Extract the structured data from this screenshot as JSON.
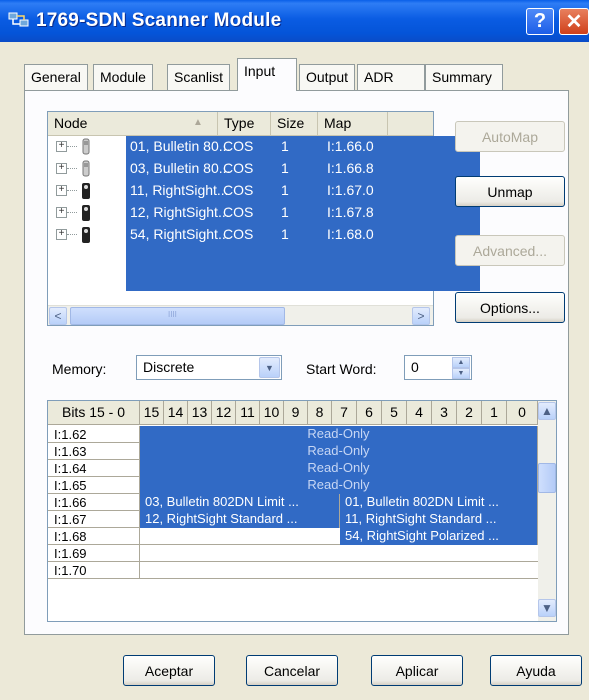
{
  "window": {
    "title": "1769-SDN Scanner Module",
    "help_label": "?",
    "close_label": "✕"
  },
  "tabs": [
    {
      "label": "General"
    },
    {
      "label": "Module"
    },
    {
      "label": "Scanlist"
    },
    {
      "label": "Input"
    },
    {
      "label": "Output"
    },
    {
      "label": "ADR"
    },
    {
      "label": "Summary"
    }
  ],
  "node_list": {
    "columns": [
      "Node",
      "Type",
      "Size",
      "Map"
    ],
    "rows": [
      {
        "node": "01, Bulletin 80...",
        "type": "COS",
        "size": "1",
        "map": "I:1.66.0",
        "icon": "limit-switch-icon"
      },
      {
        "node": "03, Bulletin 80...",
        "type": "COS",
        "size": "1",
        "map": "I:1.66.8",
        "icon": "limit-switch-icon"
      },
      {
        "node": "11, RightSight...",
        "type": "COS",
        "size": "1",
        "map": "I:1.67.0",
        "icon": "photoelectric-sensor-icon"
      },
      {
        "node": "12, RightSight...",
        "type": "COS",
        "size": "1",
        "map": "I:1.67.8",
        "icon": "photoelectric-sensor-icon"
      },
      {
        "node": "54, RightSight...",
        "type": "COS",
        "size": "1",
        "map": "I:1.68.0",
        "icon": "photoelectric-sensor-icon"
      }
    ],
    "scroll_left": "<",
    "scroll_right": ">",
    "thumb_grip": "IIII"
  },
  "buttons": {
    "automap": "AutoMap",
    "unmap": "Unmap",
    "advanced": "Advanced...",
    "options": "Options..."
  },
  "memory": {
    "label": "Memory:",
    "value": "Discrete",
    "start_word_label": "Start Word:",
    "start_word_value": "0"
  },
  "bit_grid": {
    "header_label": "Bits 15 - 0",
    "bits": [
      "15",
      "14",
      "13",
      "12",
      "11",
      "10",
      "9",
      "8",
      "7",
      "6",
      "5",
      "4",
      "3",
      "2",
      "1",
      "0"
    ],
    "rows": [
      {
        "label": "I:1.62",
        "full": "Read-Only"
      },
      {
        "label": "I:1.63",
        "full": "Read-Only"
      },
      {
        "label": "I:1.64",
        "full": "Read-Only"
      },
      {
        "label": "I:1.65",
        "full": "Read-Only"
      },
      {
        "label": "I:1.66",
        "high": "03, Bulletin 802DN Limit ...",
        "low": "01, Bulletin 802DN Limit ..."
      },
      {
        "label": "I:1.67",
        "high": "12, RightSight Standard ...",
        "low": "11, RightSight Standard ..."
      },
      {
        "label": "I:1.68",
        "high": "",
        "low": "54, RightSight Polarized ..."
      },
      {
        "label": "I:1.69"
      },
      {
        "label": "I:1.70"
      }
    ]
  },
  "footer": {
    "ok": "Aceptar",
    "cancel": "Cancelar",
    "apply": "Aplicar",
    "help": "Ayuda"
  },
  "colors": {
    "titlebar": "#0a5ce3",
    "selection": "#316ac5",
    "face": "#ece9d8"
  }
}
